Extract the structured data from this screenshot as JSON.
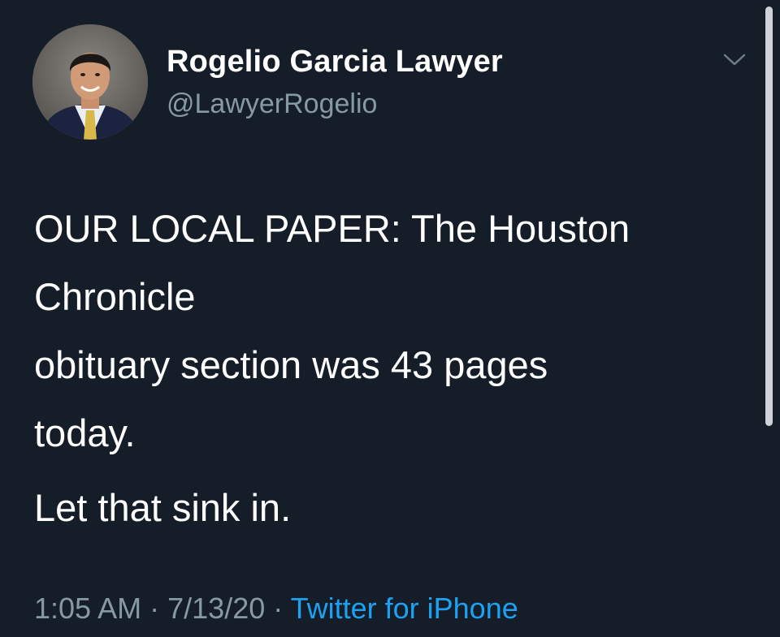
{
  "author": {
    "display_name": "Rogelio Garcia Lawyer",
    "handle": "@LawyerRogelio"
  },
  "tweet": {
    "lines": [
      "OUR LOCAL PAPER: The Houston",
      "Chronicle",
      "obituary section was 43 pages",
      "today."
    ],
    "closing": "Let that sink in."
  },
  "meta": {
    "time": "1:05 AM",
    "separator": "·",
    "date": "7/13/20",
    "source": "Twitter for iPhone"
  },
  "icons": {
    "menu": "chevron-down-icon"
  },
  "colors": {
    "background": "#151d29",
    "text": "#ffffff",
    "secondary_text": "#8899a6",
    "link": "#1da1f2"
  }
}
